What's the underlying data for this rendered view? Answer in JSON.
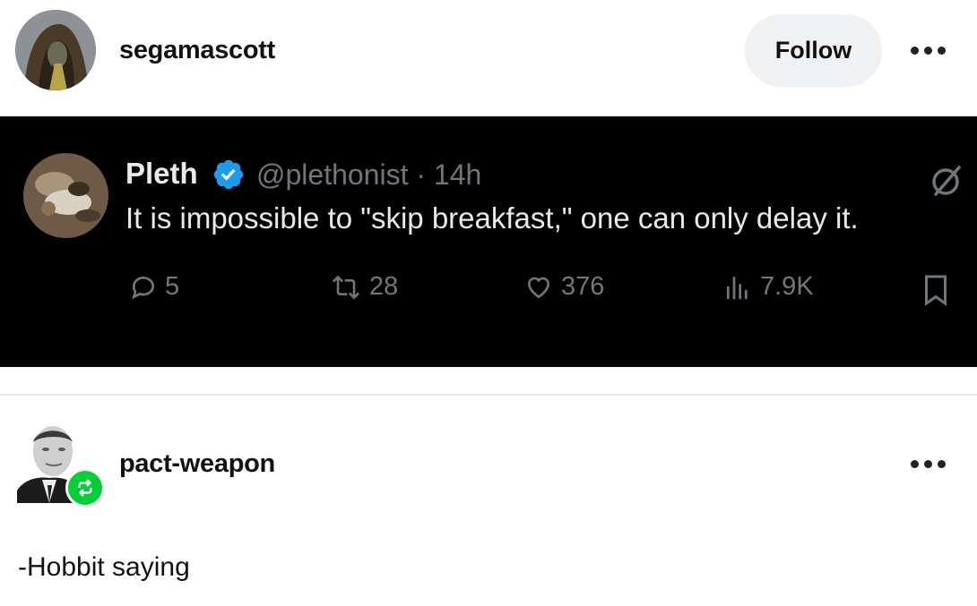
{
  "post": {
    "author": "segamascott",
    "follow_label": "Follow",
    "more_icon": "more-horizontal-icon"
  },
  "tweet": {
    "display_name": "Pleth",
    "verified": true,
    "handle_time": "@plethonist · 14h",
    "text": "It is impossible to \"skip breakfast,\" one can only delay it.",
    "metrics": {
      "replies": "5",
      "reposts": "28",
      "likes": "376",
      "views": "7.9K"
    },
    "colors": {
      "background": "#000000",
      "text": "#e7e9ea",
      "muted": "#71767b",
      "verified_blue": "#1d9bf0"
    }
  },
  "reblog": {
    "author": "pact-weapon",
    "comment": "-Hobbit saying",
    "badge_color": "#00cf35"
  }
}
